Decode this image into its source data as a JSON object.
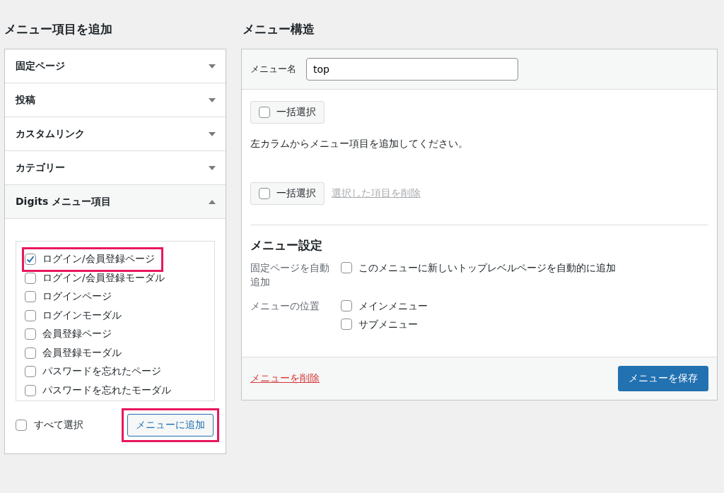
{
  "add_items": {
    "heading": "メニュー項目を追加",
    "sections": [
      {
        "title": "固定ページ",
        "expanded": false
      },
      {
        "title": "投稿",
        "expanded": false
      },
      {
        "title": "カスタムリンク",
        "expanded": false
      },
      {
        "title": "カテゴリー",
        "expanded": false
      },
      {
        "title": "Digits メニュー項目",
        "expanded": true
      }
    ],
    "items": [
      {
        "label": "ログイン/会員登録ページ",
        "checked": true,
        "highlighted": true
      },
      {
        "label": "ログイン/会員登録モーダル",
        "checked": false,
        "highlighted": false
      },
      {
        "label": "ログインページ",
        "checked": false,
        "highlighted": false
      },
      {
        "label": "ログインモーダル",
        "checked": false,
        "highlighted": false
      },
      {
        "label": "会員登録ページ",
        "checked": false,
        "highlighted": false
      },
      {
        "label": "会員登録モーダル",
        "checked": false,
        "highlighted": false
      },
      {
        "label": "パスワードを忘れたページ",
        "checked": false,
        "highlighted": false
      },
      {
        "label": "パスワードを忘れたモーダル",
        "checked": false,
        "highlighted": false
      }
    ],
    "select_all": {
      "label": "すべて選択",
      "checked": false
    },
    "add_button": {
      "label": "メニューに追加",
      "highlighted": true
    }
  },
  "structure": {
    "heading": "メニュー構造",
    "name_label": "メニュー名",
    "name_value": "top",
    "bulk_top": {
      "label": "一括選択",
      "checked": false
    },
    "instruction": "左カラムからメニュー項目を追加してください。",
    "bulk_bottom": {
      "label": "一括選択",
      "checked": false
    },
    "delete_selected": "選択した項目を削除",
    "settings_heading": "メニュー設定",
    "auto_add_label": "固定ページを自動追加",
    "auto_add": {
      "label": "このメニューに新しいトップレベルページを自動的に追加",
      "checked": false
    },
    "location_label": "メニューの位置",
    "locations": [
      {
        "label": "メインメニュー",
        "checked": false
      },
      {
        "label": "サブメニュー",
        "checked": false
      }
    ],
    "delete_menu": "メニューを削除",
    "save_button": "メニューを保存"
  }
}
